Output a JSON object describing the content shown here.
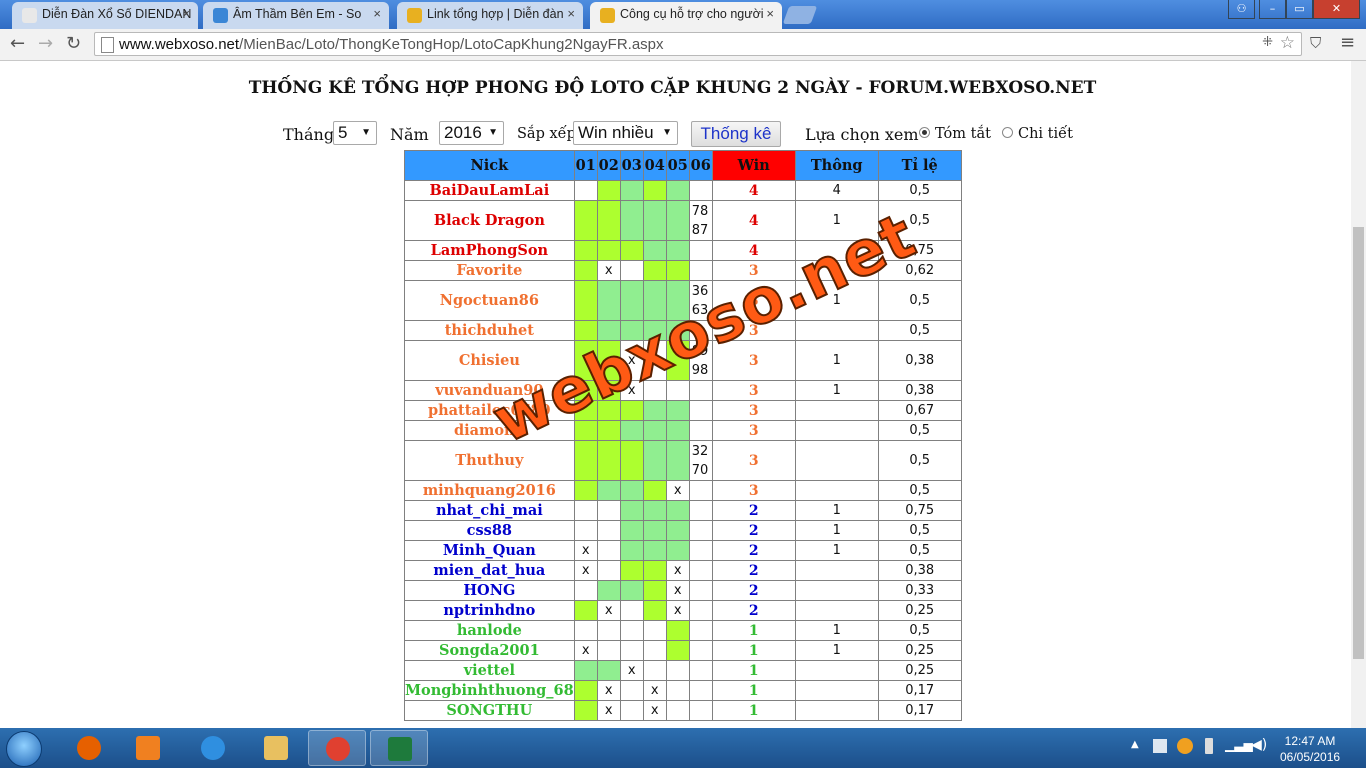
{
  "browser": {
    "tabs": [
      {
        "title": "Diễn Đàn Xổ Số DIENDAN",
        "favicon_color": "#e8e8e8",
        "active": false
      },
      {
        "title": "Âm Thầm Bên Em - So",
        "favicon_color": "#3a86d6",
        "active": false
      },
      {
        "title": "Link tổng hợp | Diễn đàn",
        "favicon_color": "#e8b020",
        "active": false
      },
      {
        "title": "Công cụ hỗ trợ cho người",
        "favicon_color": "#e8b020",
        "active": true
      }
    ],
    "url_host": "www.webxoso.net",
    "url_path": "/MienBac/Loto/ThongKeTongHop/LotoCapKhung2NgayFR.aspx"
  },
  "page": {
    "title": "THỐNG KÊ TỔNG HỢP PHONG ĐỘ LOTO CẶP KHUNG 2 NGÀY - FORUM.WEBXOSO.NET",
    "controls": {
      "month_label": "Tháng",
      "month_value": "5",
      "year_label": "Năm",
      "year_value": "2016",
      "sort_label": "Sắp xếp",
      "sort_value": "Win nhiều",
      "submit_label": "Thống kê",
      "view_label": "Lựa chọn xem",
      "view_options": [
        {
          "label": "Tóm tắt",
          "checked": true
        },
        {
          "label": "Chi tiết",
          "checked": false
        }
      ]
    },
    "table": {
      "headers": [
        "Nick",
        "01",
        "02",
        "03",
        "04",
        "05",
        "06",
        "Win",
        "Thông",
        "Tỉ lệ"
      ],
      "rows": [
        {
          "nick": "BaiDauLamLai",
          "color": "#dd0000",
          "days": [
            "",
            "g",
            "l",
            "g",
            "l",
            ""
          ],
          "d6": "",
          "win": "4",
          "thong": "4",
          "tile": "0,5"
        },
        {
          "nick": "Black Dragon",
          "color": "#dd0000",
          "days": [
            "g",
            "g",
            "l",
            "l",
            "l",
            "dd"
          ],
          "d6": "78 87",
          "win": "4",
          "thong": "1",
          "tile": "0,5"
        },
        {
          "nick": "LamPhongSon",
          "color": "#dd0000",
          "days": [
            "g",
            "g",
            "g",
            "l",
            "l",
            ""
          ],
          "d6": "",
          "win": "4",
          "thong": "",
          "tile": "0,75"
        },
        {
          "nick": "Favorite",
          "color": "#f07030",
          "days": [
            "g",
            "x",
            "",
            "g",
            "g",
            ""
          ],
          "d6": "",
          "win": "3",
          "thong": "2",
          "tile": "0,62"
        },
        {
          "nick": "Ngoctuan86",
          "color": "#f07030",
          "days": [
            "g",
            "l",
            "l",
            "l",
            "l",
            "dd"
          ],
          "d6": "36 63",
          "win": "3",
          "thong": "1",
          "tile": "0,5"
        },
        {
          "nick": "thichduhet",
          "color": "#f07030",
          "days": [
            "g",
            "l",
            "l",
            "l",
            "l",
            ""
          ],
          "d6": "",
          "win": "3",
          "thong": "",
          "tile": "0,5"
        },
        {
          "nick": "Chisieu",
          "color": "#f07030",
          "days": [
            "g",
            "g",
            "x",
            "",
            "g",
            "dd"
          ],
          "d6": "89 98",
          "win": "3",
          "thong": "1",
          "tile": "0,38"
        },
        {
          "nick": "vuvanduan90",
          "color": "#f07030",
          "days": [
            "g",
            "g",
            "x",
            "",
            "",
            ""
          ],
          "d6": "",
          "win": "3",
          "thong": "1",
          "tile": "0,38"
        },
        {
          "nick": "phattailoc6789",
          "color": "#f07030",
          "days": [
            "g",
            "g",
            "g",
            "l",
            "l",
            ""
          ],
          "d6": "",
          "win": "3",
          "thong": "",
          "tile": "0,67"
        },
        {
          "nick": "diamond",
          "color": "#f07030",
          "days": [
            "g",
            "g",
            "l",
            "l",
            "l",
            ""
          ],
          "d6": "",
          "win": "3",
          "thong": "",
          "tile": "0,5"
        },
        {
          "nick": "Thuthuy",
          "color": "#f07030",
          "days": [
            "g",
            "g",
            "g",
            "l",
            "l",
            "dd"
          ],
          "d6": "32 70",
          "win": "3",
          "thong": "",
          "tile": "0,5"
        },
        {
          "nick": "minhquang2016",
          "color": "#f07030",
          "days": [
            "g",
            "l",
            "l",
            "g",
            "x",
            ""
          ],
          "d6": "",
          "win": "3",
          "thong": "",
          "tile": "0,5"
        },
        {
          "nick": "nhat_chi_mai",
          "color": "#0000cc",
          "days": [
            "",
            "",
            "l",
            "l",
            "l",
            ""
          ],
          "d6": "",
          "win": "2",
          "thong": "1",
          "tile": "0,75"
        },
        {
          "nick": "css88",
          "color": "#0000cc",
          "days": [
            "",
            "",
            "l",
            "l",
            "l",
            ""
          ],
          "d6": "",
          "win": "2",
          "thong": "1",
          "tile": "0,5"
        },
        {
          "nick": "Minh_Quan",
          "color": "#0000cc",
          "days": [
            "x",
            "",
            "l",
            "l",
            "l",
            ""
          ],
          "d6": "",
          "win": "2",
          "thong": "1",
          "tile": "0,5"
        },
        {
          "nick": "mien_dat_hua",
          "color": "#0000cc",
          "days": [
            "x",
            "",
            "g",
            "g",
            "x",
            ""
          ],
          "d6": "",
          "win": "2",
          "thong": "",
          "tile": "0,38"
        },
        {
          "nick": "HONG",
          "color": "#0000cc",
          "days": [
            "",
            "l",
            "l",
            "g",
            "x",
            ""
          ],
          "d6": "",
          "win": "2",
          "thong": "",
          "tile": "0,33"
        },
        {
          "nick": "nptrinhdno",
          "color": "#0000cc",
          "days": [
            "g",
            "x",
            "",
            "g",
            "x",
            ""
          ],
          "d6": "",
          "win": "2",
          "thong": "",
          "tile": "0,25"
        },
        {
          "nick": "hanlode",
          "color": "#33bb33",
          "days": [
            "",
            "",
            "",
            "",
            "g",
            ""
          ],
          "d6": "",
          "win": "1",
          "thong": "1",
          "tile": "0,5"
        },
        {
          "nick": "Songda2001",
          "color": "#33bb33",
          "days": [
            "x",
            "",
            "",
            "",
            "g",
            ""
          ],
          "d6": "",
          "win": "1",
          "thong": "1",
          "tile": "0,25"
        },
        {
          "nick": "viettel",
          "color": "#33bb33",
          "days": [
            "l",
            "l",
            "x",
            "",
            "",
            ""
          ],
          "d6": "",
          "win": "1",
          "thong": "",
          "tile": "0,25"
        },
        {
          "nick": "Mongbinhthuong_68",
          "color": "#33bb33",
          "days": [
            "g",
            "x",
            "",
            "x",
            "",
            ""
          ],
          "d6": "",
          "win": "1",
          "thong": "",
          "tile": "0,17"
        },
        {
          "nick": "SONGTHU",
          "color": "#33bb33",
          "days": [
            "g",
            "x",
            "",
            "x",
            "",
            ""
          ],
          "d6": "",
          "win": "1",
          "thong": "",
          "tile": "0,17"
        }
      ]
    },
    "watermark": "webxoso.net"
  },
  "taskbar": {
    "apps": [
      {
        "name": "firefox-icon",
        "color": "#e66000",
        "open": false
      },
      {
        "name": "media-player-icon",
        "color": "#f08020",
        "open": false
      },
      {
        "name": "internet-explorer-icon",
        "color": "#2f8fe0",
        "open": false
      },
      {
        "name": "file-explorer-icon",
        "color": "#e8c060",
        "open": false
      },
      {
        "name": "chrome-icon",
        "color": "#e04030",
        "open": true
      },
      {
        "name": "excel-icon",
        "color": "#1e7a3c",
        "open": true
      }
    ],
    "time": "12:47 AM",
    "date": "06/05/2016"
  }
}
